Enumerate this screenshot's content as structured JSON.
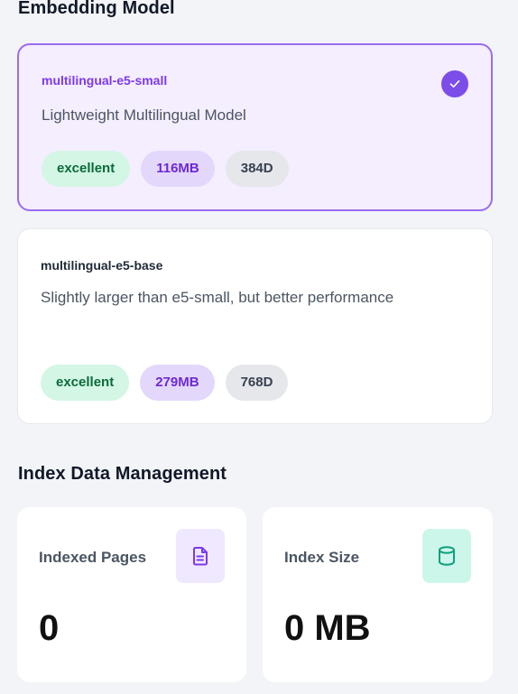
{
  "embedding_section": {
    "title": "Embedding Model",
    "models": [
      {
        "name": "multilingual-e5-small",
        "description": "Lightweight Multilingual Model",
        "selected": true,
        "badges": [
          "excellent",
          "116MB",
          "384D"
        ]
      },
      {
        "name": "multilingual-e5-base",
        "description": "Slightly larger than e5-small, but better performance",
        "selected": false,
        "badges": [
          "excellent",
          "279MB",
          "768D"
        ]
      }
    ]
  },
  "index_section": {
    "title": "Index Data Management",
    "stats": [
      {
        "label": "Indexed Pages",
        "value": "0",
        "icon": "document-icon"
      },
      {
        "label": "Index Size",
        "value": "0 MB",
        "icon": "database-icon"
      }
    ]
  },
  "colors": {
    "accent": "#7c4de8",
    "selected_card_bg": "#f4eeff",
    "quality_badge_bg": "#d4f6e5",
    "size_badge_bg": "#e3d8fb",
    "dim_badge_bg": "#e5e7eb"
  }
}
